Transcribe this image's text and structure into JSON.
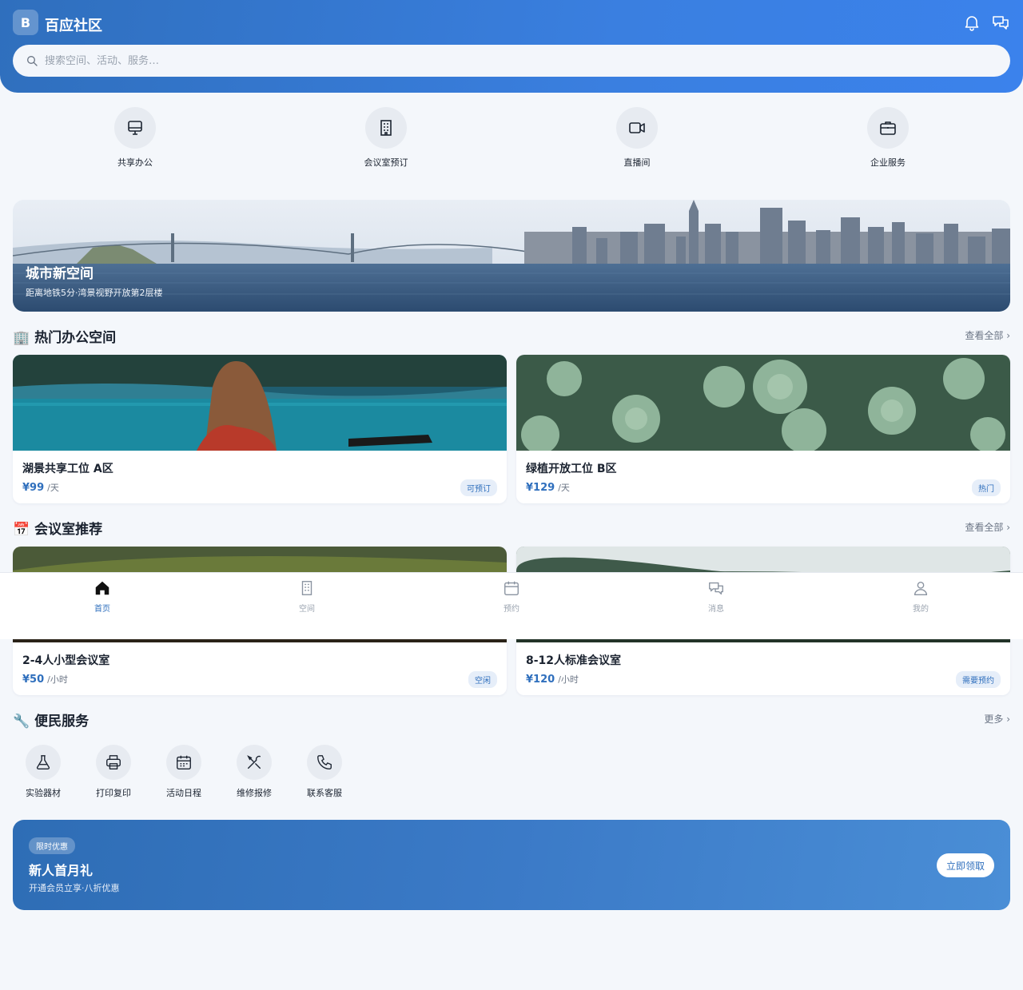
{
  "header": {
    "logo_letter": "B",
    "app_title": "百应社区",
    "search_placeholder": "搜索空间、活动、服务…"
  },
  "categories": [
    {
      "label": "共享办公",
      "icon": "desktop-icon"
    },
    {
      "label": "会议室预订",
      "icon": "building-icon"
    },
    {
      "label": "直播间",
      "icon": "video-icon"
    },
    {
      "label": "企业服务",
      "icon": "briefcase-icon"
    }
  ],
  "banner": {
    "title": "城市新空间",
    "subtitle": "距离地铁5分·湾景视野开放第2层楼"
  },
  "section_spaces": {
    "title": "🏢 热门办公空间",
    "more": "查看全部 ›",
    "cards": [
      {
        "name": "湖景共享工位 A区",
        "price": "¥99",
        "unit": "/天",
        "tag": "可预订"
      },
      {
        "name": "绿植开放工位 B区",
        "price": "¥129",
        "unit": "/天",
        "tag": "热门"
      }
    ]
  },
  "section_meeting": {
    "title": "📅 会议室推荐",
    "more": "查看全部 ›",
    "cards": [
      {
        "name": "2-4人小型会议室",
        "price": "¥50",
        "unit": "/小时",
        "tag": "空闲"
      },
      {
        "name": "8-12人标准会议室",
        "price": "¥120",
        "unit": "/小时",
        "tag": "需要预约"
      }
    ]
  },
  "section_services": {
    "title": "🔧 便民服务",
    "more": "更多 ›",
    "items": [
      {
        "label": "实验器材",
        "icon": "flask-icon"
      },
      {
        "label": "打印复印",
        "icon": "printer-icon"
      },
      {
        "label": "活动日程",
        "icon": "calendar-icon"
      },
      {
        "label": "维修报修",
        "icon": "tools-icon"
      },
      {
        "label": "联系客服",
        "icon": "phone-icon"
      }
    ]
  },
  "promo": {
    "tag": "限时优惠",
    "title": "新人首月礼",
    "subtitle": "开通会员立享·八折优惠",
    "button": "立即领取"
  },
  "bottom_nav": [
    {
      "label": "首页",
      "icon": "home-icon",
      "active": true
    },
    {
      "label": "空间",
      "icon": "building-icon",
      "active": false
    },
    {
      "label": "预约",
      "icon": "calendar-icon",
      "active": false
    },
    {
      "label": "消息",
      "icon": "chat-icon",
      "active": false
    },
    {
      "label": "我的",
      "icon": "user-icon",
      "active": false
    }
  ],
  "colors": {
    "primary": "#2f6fbd",
    "header_end": "#3b82ec",
    "background": "#f4f7fb"
  }
}
